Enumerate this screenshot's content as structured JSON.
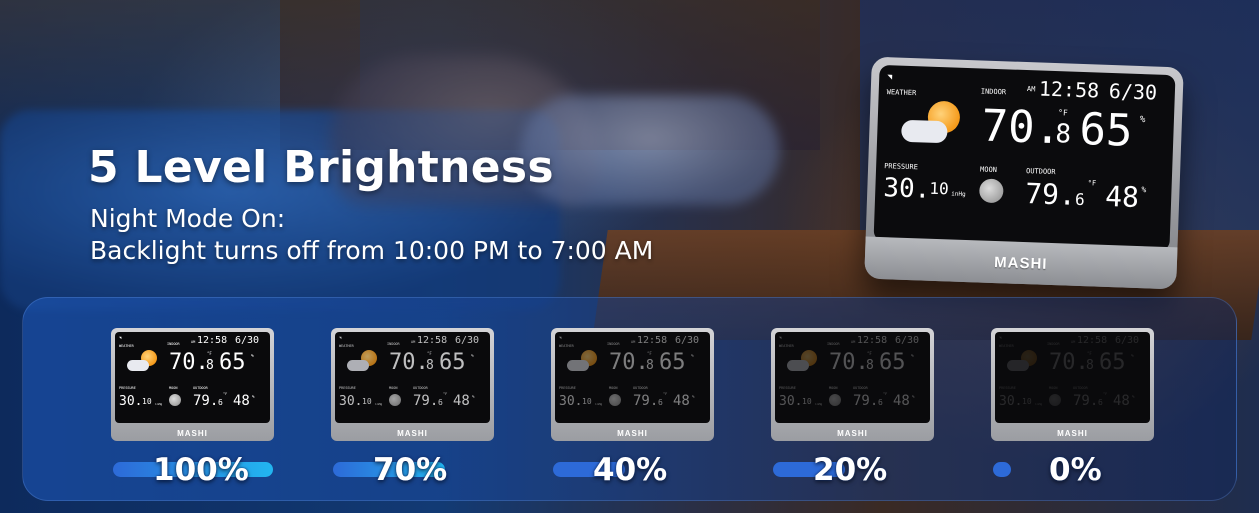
{
  "headline": "5 Level Brightness",
  "subtitle_line1": "Night Mode On:",
  "subtitle_line2": "Backlight turns off from 10:00 PM to 7:00 AM",
  "brand": "MASHI",
  "display": {
    "weather_label": "WEATHER",
    "indoor_label": "INDOOR",
    "outdoor_label": "OUTDOOR",
    "pressure_label": "PRESSURE",
    "moon_label": "MOON",
    "time": "12:58",
    "time_suffix": "AM",
    "date": "6/30",
    "indoor_temp_main": "70.",
    "indoor_temp_decimal": "8",
    "indoor_humidity": "65",
    "pressure_main": "30.",
    "pressure_decimal": "10",
    "pressure_unit": "inHg",
    "outdoor_temp_main": "79.",
    "outdoor_temp_decimal": "6",
    "outdoor_humidity": "48",
    "temp_unit": "°F",
    "humidity_unit": "%"
  },
  "levels": [
    {
      "label": "100%",
      "brightness": 1.0
    },
    {
      "label": "70%",
      "brightness": 0.7
    },
    {
      "label": "40%",
      "brightness": 0.4
    },
    {
      "label": "20%",
      "brightness": 0.2
    },
    {
      "label": "0%",
      "brightness": 0.0
    }
  ],
  "colors": {
    "accent_blue": "#2d6ad8",
    "light_blue": "#22b6f0",
    "sun": "#f59a1a"
  }
}
